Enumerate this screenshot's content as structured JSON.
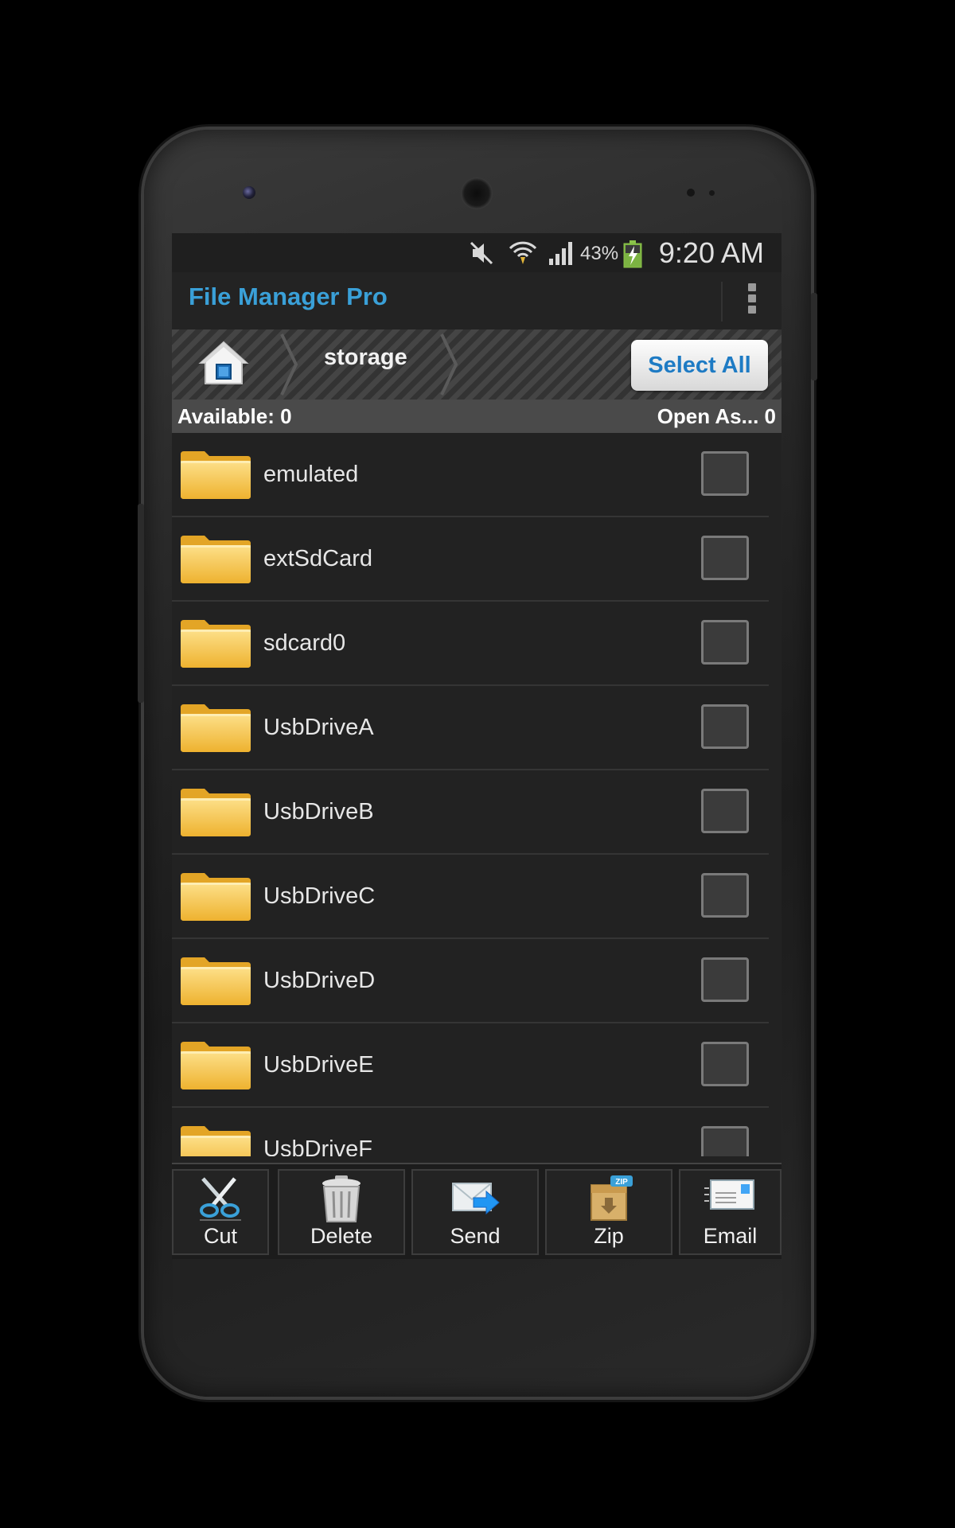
{
  "status_bar": {
    "battery_percent": "43%",
    "time": "9:20 AM",
    "icons": [
      "mute-icon",
      "wifi-icon",
      "signal-icon",
      "battery-charging-icon"
    ]
  },
  "action_bar": {
    "title": "File Manager Pro",
    "overflow_icon": "overflow-menu-icon"
  },
  "path_bar": {
    "home_icon": "home-icon",
    "crumb": "storage",
    "select_all_label": "Select All"
  },
  "info_bar": {
    "available": "Available: 0",
    "open_as": "Open As... 0"
  },
  "files": [
    {
      "name": "emulated",
      "checked": false
    },
    {
      "name": "extSdCard",
      "checked": false
    },
    {
      "name": "sdcard0",
      "checked": false
    },
    {
      "name": "UsbDriveA",
      "checked": false
    },
    {
      "name": "UsbDriveB",
      "checked": false
    },
    {
      "name": "UsbDriveC",
      "checked": false
    },
    {
      "name": "UsbDriveD",
      "checked": false
    },
    {
      "name": "UsbDriveE",
      "checked": false
    },
    {
      "name": "UsbDriveF",
      "checked": false
    }
  ],
  "toolbar": {
    "cut": "Cut",
    "delete": "Delete",
    "send": "Send",
    "zip": "Zip",
    "zip_badge": "ZIP",
    "email": "Email"
  },
  "colors": {
    "title_blue": "#3aa0d8",
    "select_all_text": "#1e7bc4",
    "folder_yellow": "#f5c542"
  }
}
